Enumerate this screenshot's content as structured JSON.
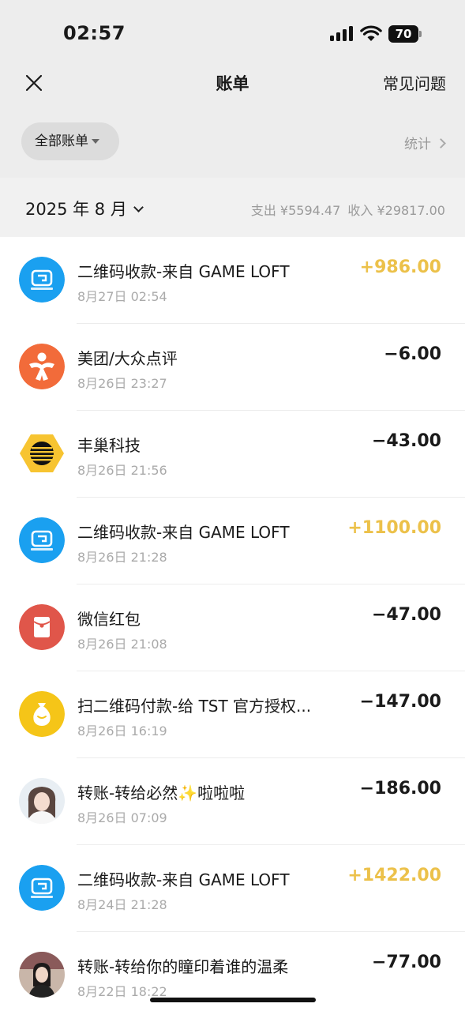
{
  "status_bar": {
    "time": "02:57",
    "battery": "70"
  },
  "nav": {
    "title": "账单",
    "faq_label": "常见问题"
  },
  "filter": {
    "label": "全部账单",
    "stats_label": "统计"
  },
  "month_bar": {
    "month": "2025 年 8 月",
    "expense_label": "支出 ¥5594.47",
    "income_label": "收入 ¥29817.00"
  },
  "transactions": [
    {
      "title": "二维码收款-来自 GAME LOFT",
      "time": "8月27日 02:54",
      "amount": "+986.00",
      "icon": "gameloft-icon",
      "type": "income"
    },
    {
      "title": "美团/大众点评",
      "time": "8月26日 23:27",
      "amount": "−6.00",
      "icon": "meituan-dianping-icon",
      "type": "expense"
    },
    {
      "title": "丰巢科技",
      "time": "8月26日 21:56",
      "amount": "−43.00",
      "icon": "fengchao-icon",
      "type": "expense"
    },
    {
      "title": "二维码收款-来自 GAME LOFT",
      "time": "8月26日 21:28",
      "amount": "+1100.00",
      "icon": "gameloft-icon",
      "type": "income"
    },
    {
      "title": "微信红包",
      "time": "8月26日 21:08",
      "amount": "−47.00",
      "icon": "red-packet-icon",
      "type": "expense"
    },
    {
      "title": "扫二维码付款-给 TST 官方授权...",
      "time": "8月26日 16:19",
      "amount": "−147.00",
      "icon": "money-bag-icon",
      "type": "expense"
    },
    {
      "title": "转账-转给必然✨啦啦啦",
      "time": "8月26日 07:09",
      "amount": "−186.00",
      "icon": "user-avatar",
      "type": "expense"
    },
    {
      "title": "二维码收款-来自 GAME LOFT",
      "time": "8月24日 21:28",
      "amount": "+1422.00",
      "icon": "gameloft-icon",
      "type": "income"
    },
    {
      "title": "转账-转给你的瞳印着谁的温柔",
      "time": "8月22日 18:22",
      "amount": "−77.00",
      "icon": "user-avatar",
      "type": "expense"
    }
  ],
  "colors": {
    "income": "#ecc14a",
    "expense": "#1a1a1a",
    "header_bg": "#ededed",
    "gameloft_blue": "#1aa0f0",
    "meituan_orange": "#f26b3a",
    "fengchao_yellow": "#f7c431",
    "red_packet": "#e0564a",
    "money_bag_yellow": "#f5c518"
  }
}
